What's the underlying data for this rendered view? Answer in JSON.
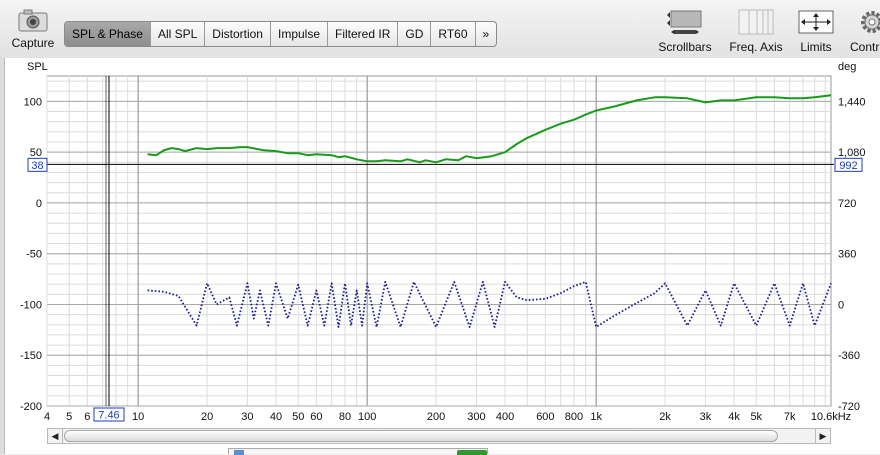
{
  "toolbar": {
    "capture_label": "Capture",
    "tabs": [
      {
        "label": "SPL & Phase",
        "active": true
      },
      {
        "label": "All SPL",
        "active": false
      },
      {
        "label": "Distortion",
        "active": false
      },
      {
        "label": "Impulse",
        "active": false
      },
      {
        "label": "Filtered IR",
        "active": false
      },
      {
        "label": "GD",
        "active": false
      },
      {
        "label": "RT60",
        "active": false
      }
    ],
    "overflow_label": "»",
    "scrollbars_label": "Scrollbars",
    "freq_axis_label": "Freq. Axis",
    "limits_label": "Limits",
    "controls_label": "Contr"
  },
  "graph": {
    "left_unit": "SPL",
    "right_unit": "deg",
    "cursor_x_readout": "7.46",
    "cursor_left_readout": "38",
    "cursor_right_readout": "992",
    "colors": {
      "spl": "#1a9a1a",
      "phase": "#1a1a9a",
      "cursor_label": "#1c3fb8"
    }
  },
  "chart_data": {
    "type": "line",
    "x_scale": "log",
    "xlim": [
      4,
      10600
    ],
    "x_ticks": [
      {
        "value": 4,
        "label": "4"
      },
      {
        "value": 5,
        "label": "5"
      },
      {
        "value": 6,
        "label": "6"
      },
      {
        "value": 10,
        "label": "10"
      },
      {
        "value": 20,
        "label": "20"
      },
      {
        "value": 30,
        "label": "30"
      },
      {
        "value": 40,
        "label": "40"
      },
      {
        "value": 50,
        "label": "50"
      },
      {
        "value": 60,
        "label": "60"
      },
      {
        "value": 80,
        "label": "80"
      },
      {
        "value": 100,
        "label": "100"
      },
      {
        "value": 200,
        "label": "200"
      },
      {
        "value": 300,
        "label": "300"
      },
      {
        "value": 400,
        "label": "400"
      },
      {
        "value": 600,
        "label": "600"
      },
      {
        "value": 800,
        "label": "800"
      },
      {
        "value": 1000,
        "label": "1k"
      },
      {
        "value": 2000,
        "label": "2k"
      },
      {
        "value": 3000,
        "label": "3k"
      },
      {
        "value": 4000,
        "label": "4k"
      },
      {
        "value": 5000,
        "label": "5k"
      },
      {
        "value": 7000,
        "label": "7k"
      },
      {
        "value": 10600,
        "label": "10.6kHz"
      }
    ],
    "ylim": [
      -200,
      125
    ],
    "y_ticks": [
      100,
      50,
      0,
      -50,
      -100,
      -150,
      -200
    ],
    "y2lim": [
      -720,
      1620
    ],
    "y2_ticks": [
      1440,
      1080,
      720,
      360,
      0,
      -360,
      -720
    ],
    "y2_tick_labels": [
      "1,440",
      "1,080",
      "720",
      "360",
      "0",
      "-360",
      "-720"
    ],
    "cursor": {
      "x": 7.46,
      "y": 38,
      "y2": 992
    },
    "series": [
      {
        "style": "solid",
        "axis": "left",
        "color": "#1a9a1a",
        "x": [
          11,
          12,
          13,
          14,
          15,
          16,
          18,
          20,
          22,
          25,
          28,
          30,
          35,
          40,
          45,
          50,
          55,
          60,
          70,
          75,
          80,
          90,
          100,
          110,
          120,
          140,
          150,
          170,
          180,
          200,
          220,
          250,
          270,
          300,
          350,
          400,
          450,
          500,
          600,
          700,
          800,
          900,
          1000,
          1200,
          1500,
          1800,
          2000,
          2500,
          3000,
          3500,
          4000,
          5000,
          6000,
          7000,
          8000,
          9000,
          10600
        ],
        "y": [
          48,
          47,
          52,
          54,
          53,
          51,
          54,
          53,
          54,
          54,
          55,
          55,
          52,
          51,
          49,
          49,
          47,
          48,
          47,
          45,
          46,
          43,
          41,
          41,
          42,
          41,
          43,
          40,
          42,
          40,
          43,
          42,
          46,
          44,
          46,
          50,
          58,
          64,
          72,
          78,
          82,
          87,
          91,
          95,
          101,
          104,
          104,
          103,
          99,
          101,
          101,
          104,
          104,
          103,
          103,
          104,
          106
        ]
      },
      {
        "style": "dotted",
        "axis": "right",
        "color": "#1a1a9a",
        "x": [
          11,
          13,
          15,
          18,
          20,
          22,
          25,
          27,
          30,
          32,
          34,
          37,
          40,
          45,
          50,
          55,
          60,
          65,
          70,
          75,
          80,
          85,
          90,
          95,
          100,
          110,
          120,
          140,
          160,
          200,
          240,
          280,
          320,
          360,
          400,
          450,
          500,
          600,
          700,
          800,
          900,
          1000,
          1200,
          1500,
          1800,
          2000,
          2500,
          3000,
          3500,
          4000,
          5000,
          6000,
          7000,
          8000,
          9000,
          10600
        ],
        "y": [
          100,
          90,
          60,
          -150,
          150,
          0,
          50,
          -150,
          150,
          -100,
          100,
          -150,
          150,
          -100,
          140,
          -150,
          100,
          -150,
          150,
          -160,
          150,
          -150,
          100,
          -150,
          150,
          -160,
          160,
          -160,
          160,
          -160,
          160,
          -160,
          160,
          -160,
          160,
          50,
          30,
          40,
          80,
          130,
          160,
          -160,
          -80,
          10,
          80,
          150,
          -150,
          100,
          -150,
          150,
          -150,
          150,
          -150,
          150,
          -150,
          150
        ]
      }
    ]
  }
}
